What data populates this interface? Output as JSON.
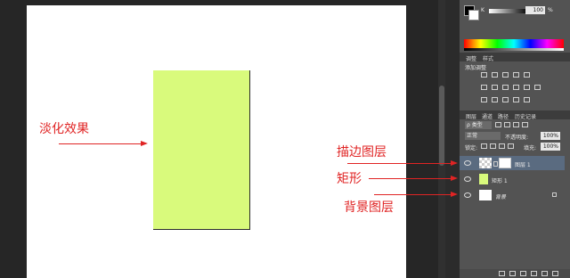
{
  "colors": {
    "accent": "#e02424",
    "shape_fill": "#d9fa7c",
    "panel": "#535353",
    "selected_layer": "#5a6b80"
  },
  "annotations": {
    "fade_effect": "淡化效果",
    "stroke_layer": "描边图层",
    "rectangle": "矩形",
    "background_layer": "背景图层"
  },
  "color_panel": {
    "channel": "K",
    "value": "100",
    "unit": "%"
  },
  "adjustments_panel": {
    "tabs": [
      "调整",
      "样式"
    ],
    "subtitle": "添加调整"
  },
  "layers_panel": {
    "tabs": [
      "图层",
      "通道",
      "路径",
      "历史记录"
    ],
    "kind_label": "ρ 类型",
    "blend_mode": "正常",
    "opacity_label": "不透明度:",
    "opacity_value": "100%",
    "lock_label": "锁定:",
    "fill_label": "填充:",
    "fill_value": "100%",
    "layers": [
      {
        "name": "图层 1",
        "selected": true
      },
      {
        "name": "矩形 1",
        "selected": false
      },
      {
        "name": "背景",
        "selected": false
      }
    ]
  }
}
